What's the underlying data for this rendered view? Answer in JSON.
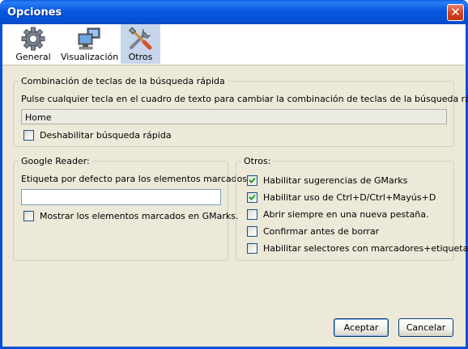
{
  "window": {
    "title": "Opciones"
  },
  "toolbar": {
    "tabs": [
      {
        "label": "General",
        "icon": "gear-icon",
        "selected": false
      },
      {
        "label": "Visualización",
        "icon": "monitor-icon",
        "selected": false
      },
      {
        "label": "Otros",
        "icon": "tools-icon",
        "selected": true
      }
    ]
  },
  "shortcut_group": {
    "title": "Combinación de teclas de la búsqueda rápida",
    "description": "Pulse cualquier tecla en el cuadro de texto para cambiar la combinación de teclas de la búsqueda rápida",
    "key_value": "Home",
    "disable_label": "Deshabilitar búsqueda rápida",
    "disable_checked": false
  },
  "reader_group": {
    "title": "Google Reader:",
    "label": "Etiqueta por defecto para los elementos marcados.",
    "tag_value": "",
    "show_label": "Mostrar los elementos marcados en GMarks.",
    "show_checked": false
  },
  "other_group": {
    "title": "Otros:",
    "options": [
      {
        "label": "Habilitar sugerencias de GMarks",
        "checked": true
      },
      {
        "label": "Habilitar uso de Ctrl+D/Ctrl+Mayús+D",
        "checked": true
      },
      {
        "label": "Abrir siempre en una nueva pestaña.",
        "checked": false
      },
      {
        "label": "Confirmar antes de borrar",
        "checked": false
      },
      {
        "label": "Habilitar selectores con marcadores+etiquetas",
        "checked": false
      }
    ]
  },
  "buttons": {
    "accept": "Aceptar",
    "cancel": "Cancelar"
  }
}
